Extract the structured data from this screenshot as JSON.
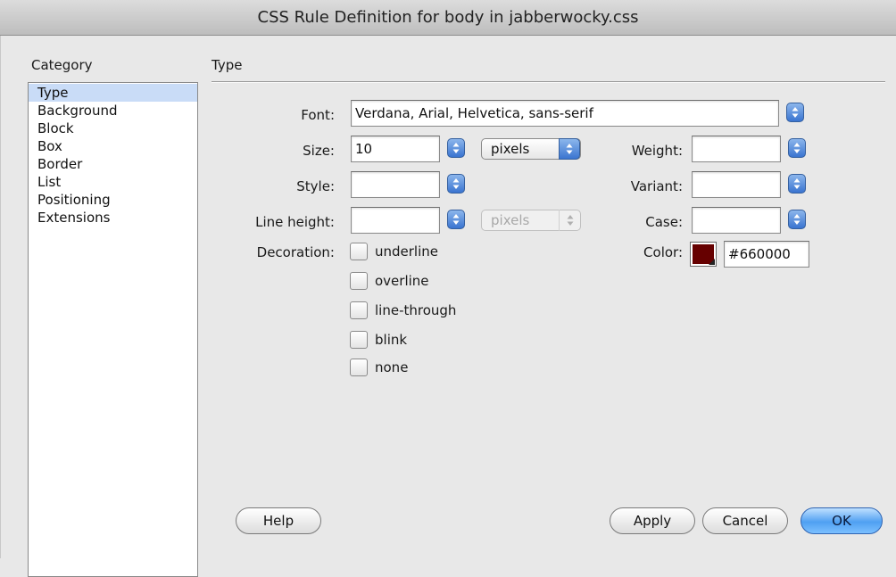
{
  "window": {
    "title": "CSS Rule Definition for body in jabberwocky.css"
  },
  "sidebar": {
    "heading": "Category",
    "items": [
      {
        "label": "Type",
        "selected": true
      },
      {
        "label": "Background"
      },
      {
        "label": "Block"
      },
      {
        "label": "Box"
      },
      {
        "label": "Border"
      },
      {
        "label": "List"
      },
      {
        "label": "Positioning"
      },
      {
        "label": "Extensions"
      }
    ]
  },
  "panel": {
    "title": "Type",
    "font": {
      "label": "Font:",
      "value": "Verdana, Arial, Helvetica, sans-serif"
    },
    "size": {
      "label": "Size:",
      "value": "10",
      "unit": "pixels"
    },
    "weight": {
      "label": "Weight:",
      "value": ""
    },
    "style": {
      "label": "Style:",
      "value": ""
    },
    "variant": {
      "label": "Variant:",
      "value": ""
    },
    "line_height": {
      "label": "Line height:",
      "value": "",
      "unit": "pixels"
    },
    "case": {
      "label": "Case:",
      "value": ""
    },
    "decoration": {
      "label": "Decoration:",
      "options": [
        "underline",
        "overline",
        "line-through",
        "blink",
        "none"
      ]
    },
    "color": {
      "label": "Color:",
      "value": "#660000",
      "swatch": "#660000"
    }
  },
  "buttons": {
    "help": "Help",
    "apply": "Apply",
    "cancel": "Cancel",
    "ok": "OK"
  }
}
